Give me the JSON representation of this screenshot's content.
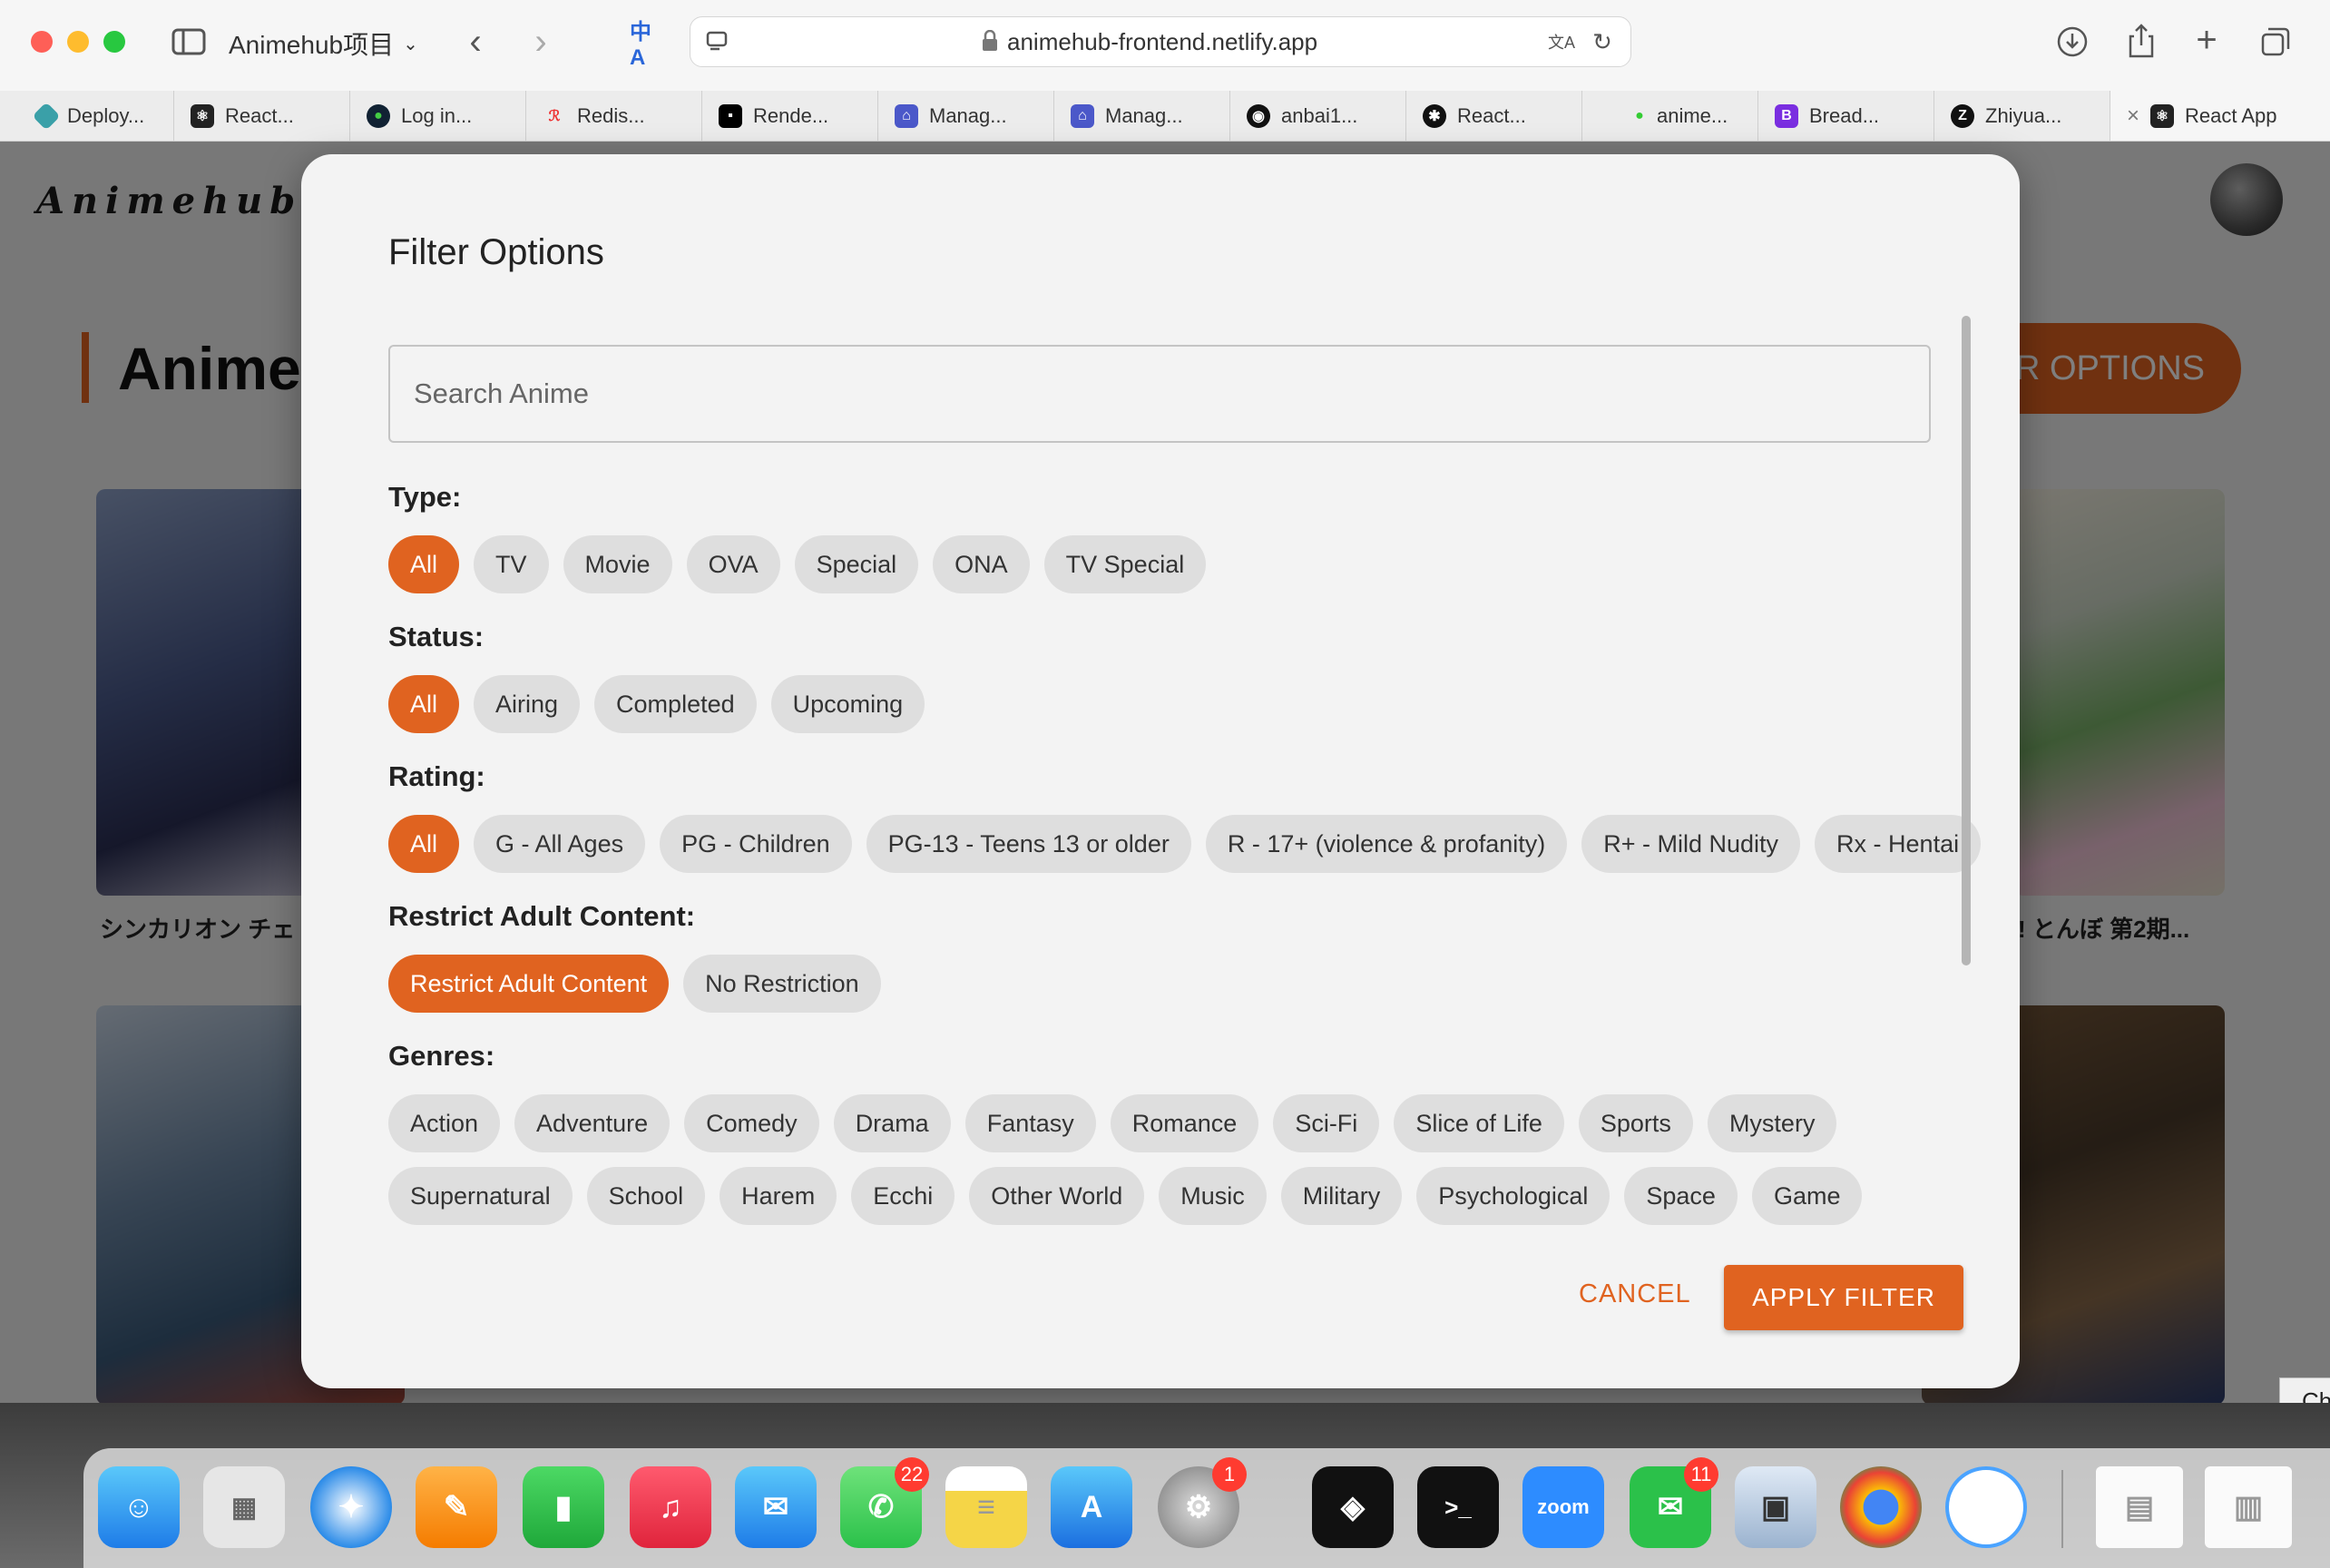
{
  "browser": {
    "sidebar_title": "Animehub项目",
    "url": "animehub-frontend.netlify.app",
    "tabs": [
      {
        "label": "Deploy..."
      },
      {
        "label": "React..."
      },
      {
        "label": "Log in..."
      },
      {
        "label": "Redis..."
      },
      {
        "label": "Rende..."
      },
      {
        "label": "Manag..."
      },
      {
        "label": "Manag..."
      },
      {
        "label": "anbai1..."
      },
      {
        "label": "React..."
      },
      {
        "label": "anime..."
      },
      {
        "label": "Bread..."
      },
      {
        "label": "Zhiyua..."
      },
      {
        "label": "React App"
      }
    ]
  },
  "page": {
    "logo": "Animehub",
    "heading": "Anime",
    "options_button": "R OPTIONS",
    "card_left_title": "シンカリオン チェ",
    "card_right_title": "! とんぼ 第2期...",
    "side_tooltip": "Ch"
  },
  "modal": {
    "title": "Filter Options",
    "search_placeholder": "Search Anime",
    "type": {
      "label": "Type:",
      "options": [
        "All",
        "TV",
        "Movie",
        "OVA",
        "Special",
        "ONA",
        "TV Special"
      ]
    },
    "status": {
      "label": "Status:",
      "options": [
        "All",
        "Airing",
        "Completed",
        "Upcoming"
      ]
    },
    "rating": {
      "label": "Rating:",
      "options": [
        "All",
        "G - All Ages",
        "PG - Children",
        "PG-13 - Teens 13 or older",
        "R - 17+ (violence & profanity)",
        "R+ - Mild Nudity",
        "Rx - Hentai"
      ]
    },
    "restrict": {
      "label": "Restrict Adult Content:",
      "options": [
        "Restrict Adult Content",
        "No Restriction"
      ]
    },
    "genres": {
      "label": "Genres:",
      "options": [
        "Action",
        "Adventure",
        "Comedy",
        "Drama",
        "Fantasy",
        "Romance",
        "Sci-Fi",
        "Slice of Life",
        "Sports",
        "Mystery",
        "Supernatural",
        "School",
        "Harem",
        "Ecchi",
        "Other World",
        "Music",
        "Military",
        "Psychological",
        "Space",
        "Game"
      ]
    },
    "cancel_label": "CANCEL",
    "apply_label": "APPLY FILTER",
    "accent_color": "#e06320"
  },
  "dock": {
    "badges": {
      "messages": "22",
      "settings": "1",
      "wechat": "11"
    }
  }
}
